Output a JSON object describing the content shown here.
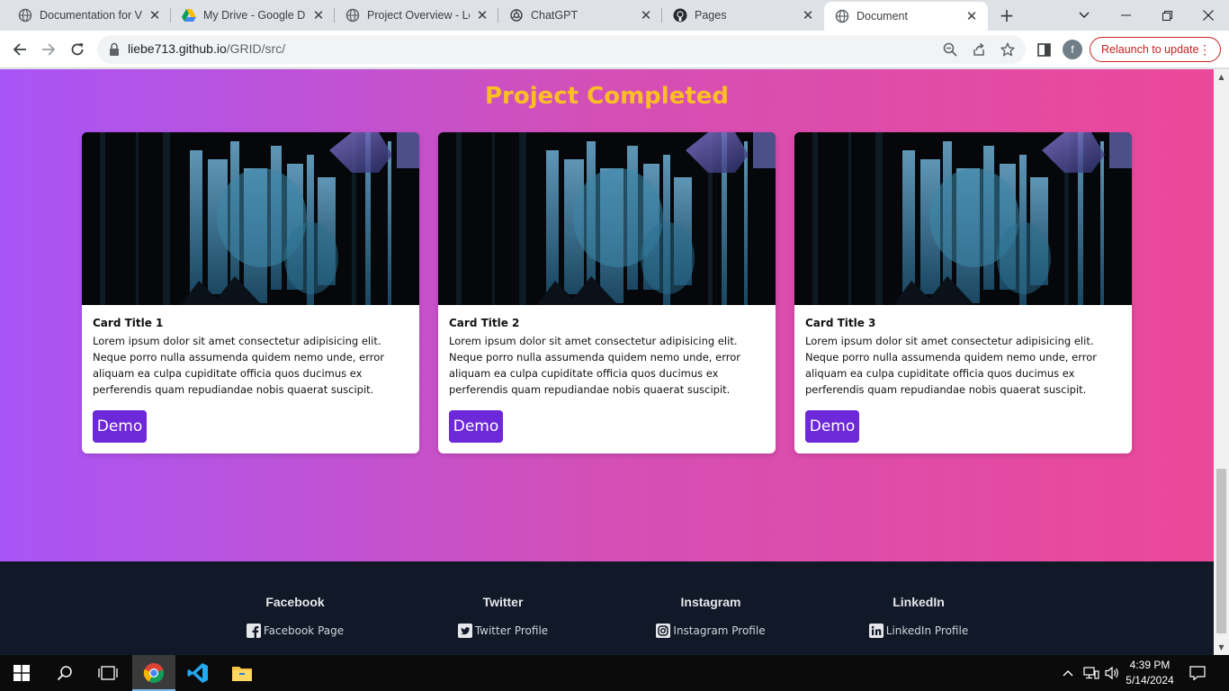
{
  "browser": {
    "tabs": [
      {
        "title": "Documentation for Vi",
        "icon": "globe-icon",
        "active": false
      },
      {
        "title": "My Drive - Google Dr",
        "icon": "google-drive-icon",
        "active": false
      },
      {
        "title": "Project Overview - Lo",
        "icon": "globe-icon",
        "active": false
      },
      {
        "title": "ChatGPT",
        "icon": "chatgpt-icon",
        "active": false
      },
      {
        "title": "Pages",
        "icon": "github-icon",
        "active": false
      },
      {
        "title": "Document",
        "icon": "globe-icon",
        "active": true
      }
    ],
    "url_host": "liebe713.github.io",
    "url_path": "/GRID/src/",
    "profile_initial": "f",
    "relaunch_label": "Relaunch to update"
  },
  "page": {
    "section_title": "Project Completed",
    "cards": [
      {
        "title": "Card Title 1",
        "text": "Lorem ipsum dolor sit amet consectetur adipisicing elit. Neque porro nulla assumenda quidem nemo unde, error aliquam ea culpa cupiditate officia quos ducimus ex perferendis quam repudiandae nobis quaerat suscipit.",
        "button": "Demo"
      },
      {
        "title": "Card Title 2",
        "text": "Lorem ipsum dolor sit amet consectetur adipisicing elit. Neque porro nulla assumenda quidem nemo unde, error aliquam ea culpa cupiditate officia quos ducimus ex perferendis quam repudiandae nobis quaerat suscipit.",
        "button": "Demo"
      },
      {
        "title": "Card Title 3",
        "text": "Lorem ipsum dolor sit amet consectetur adipisicing elit. Neque porro nulla assumenda quidem nemo unde, error aliquam ea culpa cupiditate officia quos ducimus ex perferendis quam repudiandae nobis quaerat suscipit.",
        "button": "Demo"
      }
    ],
    "footer": [
      {
        "heading": "Facebook",
        "link": "Facebook Page",
        "icon": "facebook-icon"
      },
      {
        "heading": "Twitter",
        "link": "Twitter Profile",
        "icon": "twitter-icon"
      },
      {
        "heading": "Instagram",
        "link": "Instagram Profile",
        "icon": "instagram-icon"
      },
      {
        "heading": "LinkedIn",
        "link": "LinkedIn Profile",
        "icon": "linkedin-icon"
      }
    ]
  },
  "taskbar": {
    "time": "4:39 PM",
    "date": "5/14/2024"
  },
  "colors": {
    "gradient_start": "#a855f7",
    "gradient_end": "#ec4899",
    "title": "#fbbf24",
    "demo_button": "#6d28d9",
    "footer_bg": "#111827"
  }
}
